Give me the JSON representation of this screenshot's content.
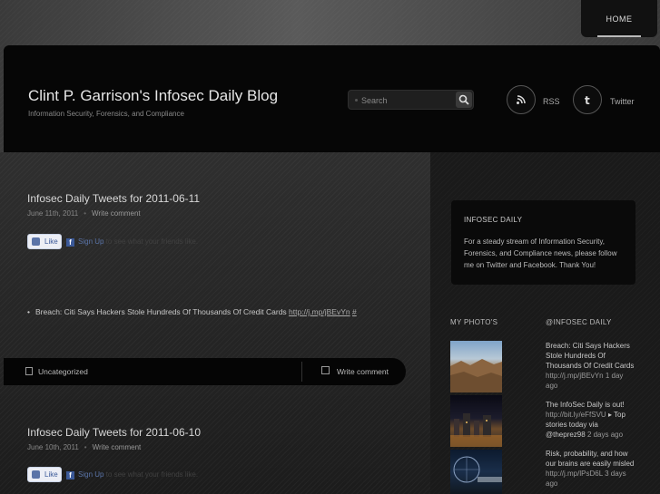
{
  "nav": {
    "home_label": "HOME"
  },
  "header": {
    "title": "Clint P. Garrison's Infosec Daily Blog",
    "tagline": "Information Security, Forensics, and Compliance",
    "search_placeholder": "Search",
    "rss_label": "RSS",
    "twitter_label": "Twitter"
  },
  "posts": [
    {
      "title": "Infosec Daily Tweets for 2011-06-11",
      "date": "June 11th, 2011",
      "comment_link": "Write comment",
      "like_label": "Like",
      "signup_link": "Sign Up",
      "signup_rest": "to see what your friends like.",
      "bullet_text": "Breach: Citi Says Hackers Stole Hundreds Of Thousands Of Credit Cards",
      "bullet_link": "http://j.mp/jBEvYn",
      "bullet_hash": "#",
      "category": "Uncategorized",
      "write_comment": "Write comment"
    },
    {
      "title": "Infosec Daily Tweets for 2011-06-10",
      "date": "June 10th, 2011",
      "comment_link": "Write comment",
      "like_label": "Like",
      "signup_link": "Sign Up",
      "signup_rest": "to see what your friends like."
    }
  ],
  "sidebar": {
    "info_title": "INFOSEC DAILY",
    "info_text": "For a steady stream of Information Security, Forensics, and Compliance news, please follow me on Twitter and Facebook. Thank You!",
    "photos_heading": "MY PHOTO'S",
    "tweets_heading": "@INFOSEC DAILY",
    "tweets": [
      {
        "text": "Breach: Citi Says Hackers Stole Hundreds Of Thousands Of Credit Cards",
        "link": "http://j.mp/jBEvYn",
        "ago": "1 day ago"
      },
      {
        "text": "The InfoSec Daily is out!",
        "link": "http://bit.ly/eFfSVU",
        "rest": "▸ Top stories today via @theprez98",
        "ago": "2 days ago"
      },
      {
        "text": "Risk, probability, and how our brains are easily misled",
        "link": "http://j.mp/lPsD6L",
        "ago": "3 days ago"
      }
    ]
  }
}
